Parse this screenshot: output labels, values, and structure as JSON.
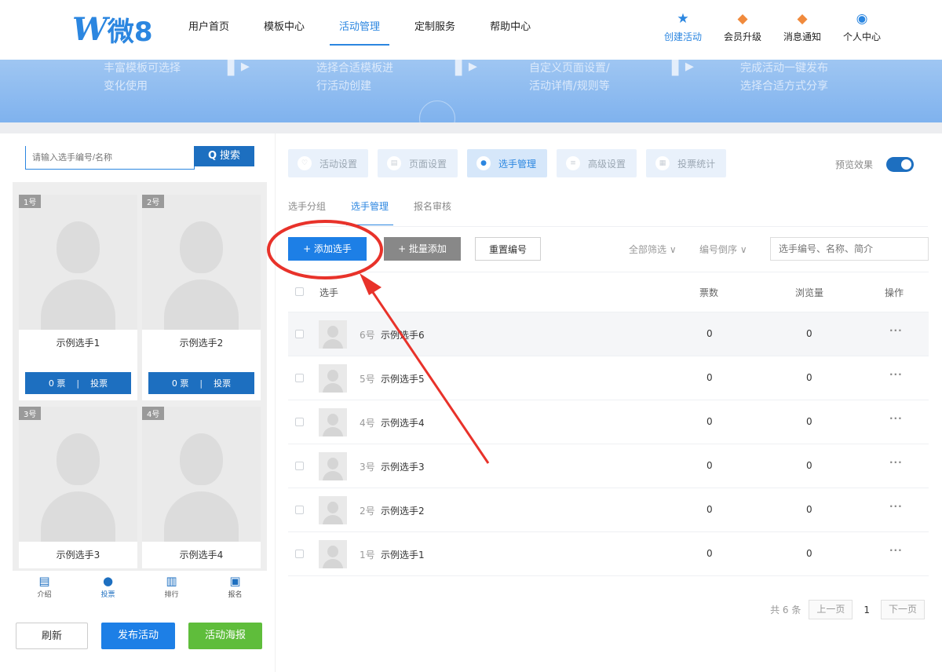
{
  "logo": {
    "mark": "W",
    "text": "微8"
  },
  "nav": {
    "items": [
      "用户首页",
      "模板中心",
      "活动管理",
      "定制服务",
      "帮助中心"
    ],
    "active_index": 2
  },
  "nav_right": [
    {
      "label": "创建活动",
      "icon": "star-icon"
    },
    {
      "label": "会员升级",
      "icon": "diamond-badge-icon"
    },
    {
      "label": "消息通知",
      "icon": "message-badge-icon"
    },
    {
      "label": "个人中心",
      "icon": "user-circle-icon"
    }
  ],
  "banner": {
    "steps": [
      [
        "丰富模板可选择",
        "变化使用"
      ],
      [
        "选择合适模板进",
        "行活动创建"
      ],
      [
        "自定义页面设置/",
        "活动详情/规则等"
      ],
      [
        "完成活动一键发布",
        "选择合适方式分享"
      ]
    ]
  },
  "left": {
    "search_placeholder": "请输入选手编号/名称",
    "search_button": "搜索",
    "cards": [
      {
        "num": "1号",
        "name": "示例选手1",
        "votes": "0 票",
        "vote_label": "投票"
      },
      {
        "num": "2号",
        "name": "示例选手2",
        "votes": "0 票",
        "vote_label": "投票"
      },
      {
        "num": "3号",
        "name": "示例选手3"
      },
      {
        "num": "4号",
        "name": "示例选手4"
      }
    ],
    "tabs": [
      {
        "label": "介绍",
        "icon": "document-icon"
      },
      {
        "label": "投票",
        "icon": "person-icon"
      },
      {
        "label": "排行",
        "icon": "bar-chart-icon"
      },
      {
        "label": "报名",
        "icon": "form-icon"
      }
    ],
    "active_tab": 1,
    "actions": {
      "refresh": "刷新",
      "publish": "发布活动",
      "poster": "活动海报"
    }
  },
  "main": {
    "steps": [
      {
        "label": "活动设置",
        "icon": "heart-icon"
      },
      {
        "label": "页面设置",
        "icon": "page-icon"
      },
      {
        "label": "选手管理",
        "icon": "person-icon"
      },
      {
        "label": "高级设置",
        "icon": "settings-icon"
      },
      {
        "label": "投票统计",
        "icon": "stats-icon"
      }
    ],
    "active_step": 2,
    "preview_label": "预览效果",
    "preview_on": true,
    "subtabs": [
      "选手分组",
      "选手管理",
      "报名审核"
    ],
    "active_subtab": 1,
    "toolbar": {
      "add": "+ 添加选手",
      "batch": "+ 批量添加",
      "renumber": "重置编号",
      "filter_all": "全部筛选 ∨",
      "filter_order": "编号倒序 ∨",
      "search_placeholder": "选手编号、名称、简介"
    },
    "table": {
      "headers": {
        "player": "选手",
        "votes": "票数",
        "views": "浏览量",
        "ops": "操作"
      },
      "rows": [
        {
          "num": "6号",
          "name": "示例选手6",
          "votes": "0",
          "views": "0",
          "ops": "···"
        },
        {
          "num": "5号",
          "name": "示例选手5",
          "votes": "0",
          "views": "0",
          "ops": "···"
        },
        {
          "num": "4号",
          "name": "示例选手4",
          "votes": "0",
          "views": "0",
          "ops": "···"
        },
        {
          "num": "3号",
          "name": "示例选手3",
          "votes": "0",
          "views": "0",
          "ops": "···"
        },
        {
          "num": "2号",
          "name": "示例选手2",
          "votes": "0",
          "views": "0",
          "ops": "···"
        },
        {
          "num": "1号",
          "name": "示例选手1",
          "votes": "0",
          "views": "0",
          "ops": "···"
        }
      ]
    },
    "pager": {
      "total": "共 6 条",
      "prev": "上一页",
      "current": "1",
      "next": "下一页"
    }
  },
  "colors": {
    "brand": "#2b86e0",
    "dark_blue": "#1d6fc0",
    "add_blue": "#1d7fe6",
    "green": "#5fbd3b",
    "annotation_red": "#e8322a"
  }
}
